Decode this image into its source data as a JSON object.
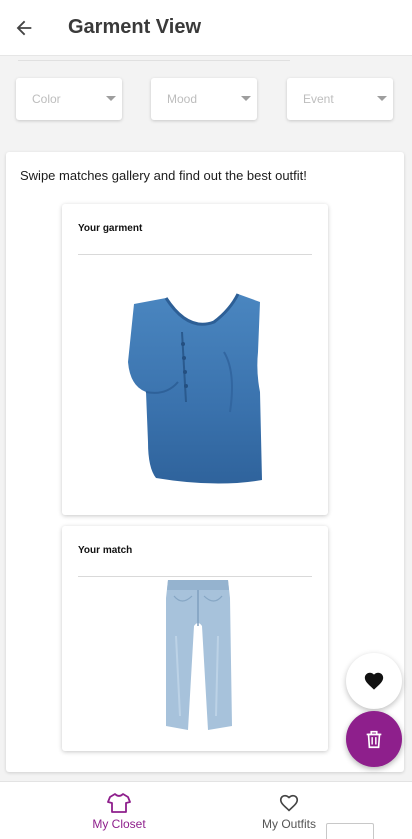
{
  "app": {
    "title": "Garment View",
    "back_icon": "arrow-left-icon"
  },
  "filters": [
    {
      "placeholder": "Color",
      "icon": "dropdown-caret-icon"
    },
    {
      "placeholder": "Mood",
      "icon": "dropdown-caret-icon"
    },
    {
      "placeholder": "Event",
      "icon": "dropdown-caret-icon"
    }
  ],
  "gallery": {
    "instructions": "Swipe matches gallery and find out the best outfit!",
    "garment_card": {
      "title": "Your garment",
      "image": "blue-shirt-image"
    },
    "match_card": {
      "title": "Your match",
      "image": "light-blue-jeans-image"
    }
  },
  "actions": {
    "like_icon": "heart-filled-icon",
    "delete_icon": "trash-icon"
  },
  "bottom_nav": [
    {
      "label": "My Closet",
      "icon": "tshirt-icon",
      "active": true
    },
    {
      "label": "My Outfits",
      "icon": "heart-outline-icon",
      "active": false
    }
  ],
  "colors": {
    "accent": "#8e1f8c",
    "shirt": "#3d78b3",
    "jeans": "#a6c1da"
  }
}
